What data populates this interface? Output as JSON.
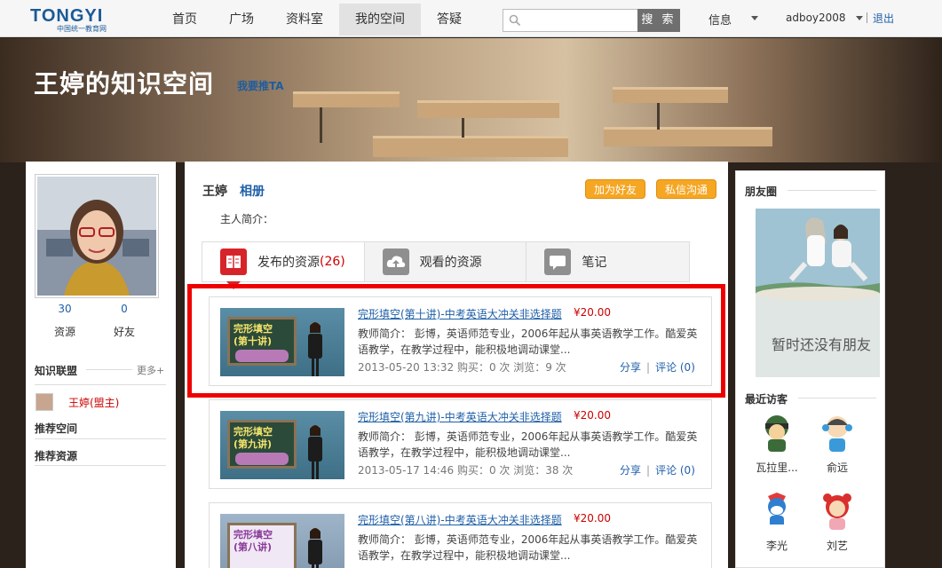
{
  "topbar": {
    "logo_text": "TONGYI",
    "logo_sub": "中国统一教育网",
    "nav": [
      "首页",
      "广场",
      "资料室",
      "我的空间",
      "答疑"
    ],
    "active_nav": "我的空间",
    "search_placeholder": "",
    "search_button": "搜 索",
    "info_label": "信息",
    "username": "adboy2008",
    "logout": "退出"
  },
  "banner": {
    "title": "王婷的知识空间",
    "recommend_link": "我要推TA"
  },
  "left": {
    "stats": [
      {
        "value": "30",
        "label": "资源"
      },
      {
        "value": "0",
        "label": "好友"
      }
    ],
    "league_title": "知识联盟",
    "more_link": "更多+",
    "league_member": "王婷(盟主)",
    "recommended_spaces": "推荐空间",
    "recommended_resources": "推荐资源"
  },
  "main": {
    "owner_name": "王婷",
    "album_link": "相册",
    "add_friend_button": "加为好友",
    "private_message_button": "私信沟通",
    "intro_label": "主人简介：",
    "tabs": [
      {
        "label": "发布的资源",
        "count": "(26)",
        "icon": "book-icon"
      },
      {
        "label": "观看的资源",
        "count": "",
        "icon": "cloud-upload-icon"
      },
      {
        "label": "笔记",
        "count": "",
        "icon": "note-icon"
      }
    ],
    "resources": [
      {
        "title": "完形填空(第十讲)-中考英语大冲关非选择题",
        "price": "¥20.00",
        "board_line1": "完形填空",
        "board_line2": "(第十讲)",
        "desc": "教师简介：      彭博，英语师范专业，2006年起从事英语教学工作。酷爱英语教学，在教学过程中，能积极地调动课堂...",
        "meta": "2013-05-20 13:32    购买：0 次    浏览：9 次",
        "share": "分享",
        "comment": "评论 (0)"
      },
      {
        "title": "完形填空(第九讲)-中考英语大冲关非选择题",
        "price": "¥20.00",
        "board_line1": "完形填空",
        "board_line2": "(第九讲)",
        "desc": "教师简介：      彭博，英语师范专业，2006年起从事英语教学工作。酷爱英语教学，在教学过程中，能积极地调动课堂...",
        "meta": "2013-05-17 14:46    购买：0 次    浏览：38 次",
        "share": "分享",
        "comment": "评论 (0)"
      },
      {
        "title": "完形填空(第八讲)-中考英语大冲关非选择题",
        "price": "¥20.00",
        "board_line1": "完形填空",
        "board_line2": "(第八讲)",
        "desc": "教师简介：      彭博，英语师范专业，2006年起从事英语教学工作。酷爱英语教学，在教学过程中，能积极地调动课堂...",
        "meta": "",
        "share": "",
        "comment": ""
      }
    ]
  },
  "right": {
    "friends_title": "朋友圈",
    "no_friends_text": "暂时还没有朋友",
    "visitors_title": "最近访客",
    "visitors": [
      "瓦拉里...",
      "俞远",
      "李光",
      "刘艺"
    ]
  },
  "colors": {
    "link_blue": "#1e5fa8",
    "price_red": "#cc0000",
    "orange_button": "#f5a623",
    "highlight_red": "#ee0000"
  }
}
